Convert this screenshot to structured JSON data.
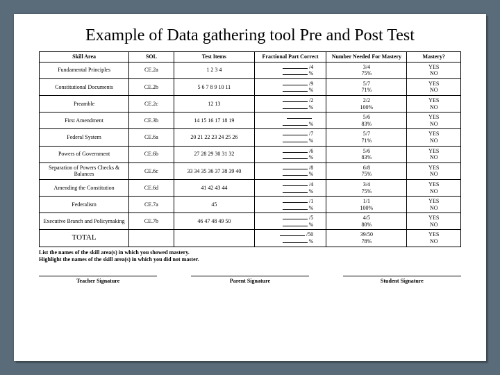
{
  "title": "Example of Data gathering tool Pre and Post Test",
  "headers": {
    "skill": "Skill Area",
    "sol": "SOL",
    "items": "Test Items",
    "frac": "Fractional Part Correct",
    "needed": "Number Needed For Mastery",
    "mastery": "Mastery?"
  },
  "rows": [
    {
      "skill": "Fundamental Principles",
      "sol": "CE.2a",
      "items": "1 2 3 4",
      "frac_top": "/4",
      "frac_bot": "%",
      "needed_a": "3/4",
      "needed_b": "75%",
      "m1": "YES",
      "m2": "NO"
    },
    {
      "skill": "Constitutional Documents",
      "sol": "CE.2b",
      "items": "5 6 7 8 9 10 11",
      "frac_top": "/9",
      "frac_bot": "%",
      "needed_a": "5/7",
      "needed_b": "71%",
      "m1": "YES",
      "m2": "NO"
    },
    {
      "skill": "Preamble",
      "sol": "CE.2c",
      "items": "12 13",
      "frac_top": "/2",
      "frac_bot": "%",
      "needed_a": "2/2",
      "needed_b": "100%",
      "m1": "YES",
      "m2": "NO"
    },
    {
      "skill": "First Amendment",
      "sol": "CE.3b",
      "items": "14 15 16 17 18 19",
      "frac_top": "",
      "frac_bot": "%",
      "needed_a": "5/6",
      "needed_b": "83%",
      "m1": "YES",
      "m2": "NO"
    },
    {
      "skill": "Federal System",
      "sol": "CE.6a",
      "items": "20 21 22 23 24 25 26",
      "frac_top": "/7",
      "frac_bot": "%",
      "needed_a": "5/7",
      "needed_b": "71%",
      "m1": "YES",
      "m2": "NO"
    },
    {
      "skill": "Powers of Government",
      "sol": "CE.6b",
      "items": "27 28 29 30 31 32",
      "frac_top": "/6",
      "frac_bot": "%",
      "needed_a": "5/6",
      "needed_b": "83%",
      "m1": "YES",
      "m2": "NO"
    },
    {
      "skill": "Separation of Powers Checks & Balances",
      "sol": "CE.6c",
      "items": "33 34 35 36 37 38 39 40",
      "frac_top": "/8",
      "frac_bot": "%",
      "needed_a": "6/8",
      "needed_b": "75%",
      "m1": "YES",
      "m2": "NO"
    },
    {
      "skill": "Amending the Constitution",
      "sol": "CE.6d",
      "items": "41 42 43 44",
      "frac_top": "/4",
      "frac_bot": "%",
      "needed_a": "3/4",
      "needed_b": "75%",
      "m1": "YES",
      "m2": "NO"
    },
    {
      "skill": "Federalism",
      "sol": "CE.7a",
      "items": "45",
      "frac_top": "/1",
      "frac_bot": "%",
      "needed_a": "1/1",
      "needed_b": "100%",
      "m1": "YES",
      "m2": "NO"
    },
    {
      "skill": "Executive Branch and Policymaking",
      "sol": "CE.7b",
      "items": "46 47 48 49 50",
      "frac_top": "/5",
      "frac_bot": "%",
      "needed_a": "4/5",
      "needed_b": "80%",
      "m1": "YES",
      "m2": "NO"
    }
  ],
  "total": {
    "label": "TOTAL",
    "frac_top": "/50",
    "frac_bot": "%",
    "needed_a": "39/50",
    "needed_b": "78%",
    "m1": "YES",
    "m2": "NO"
  },
  "instructions": {
    "line1": "List the names of the skill area(s) in which you showed mastery.",
    "line2": "Highlight the names of the skill area(s) in which you did not master."
  },
  "signatures": {
    "teacher": "Teacher Signature",
    "parent": "Parent Signature",
    "student": "Student Signature"
  }
}
